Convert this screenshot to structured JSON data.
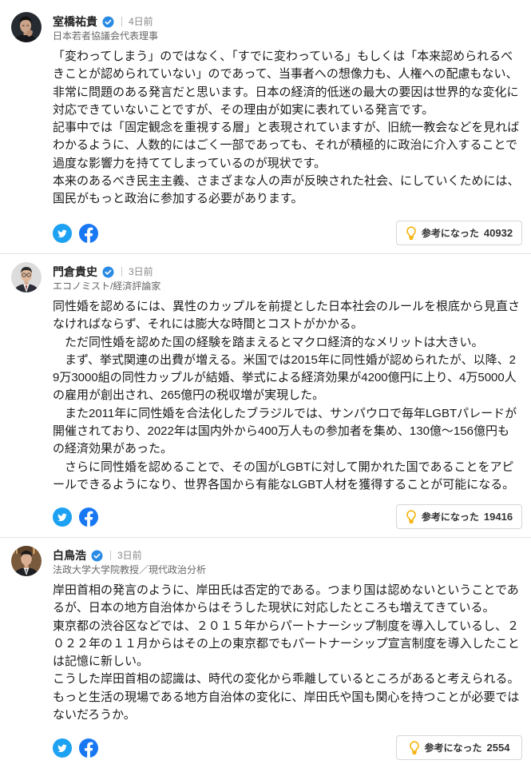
{
  "helpful_label": "参考になった",
  "comments": [
    {
      "author": "室橋祐貴",
      "badge_icon": "verified-check-icon",
      "time": "4日前",
      "title": "日本若者協議会代表理事",
      "paragraphs": [
        "「変わってしまう」のではなく、「すでに変わっている」もしくは「本来認められるべきことが認められていない」のであって、当事者への想像力も、人権への配慮もない、非常に問題のある発言だと思います。日本の経済的低迷の最大の要因は世界的な変化に対応できていないことですが、その理由が如実に表れている発言です。",
        "記事中では「固定観念を重視する層」と表現されていますが、旧統一教会などを見ればわかるように、人数的にはごく一部であっても、それが積極的に政治に介入することで過度な影響力を持ててしまっているのが現状です。",
        "本来のあるべき民主主義、さまざまな人の声が反映された社会、にしていくためには、国民がもっと政治に参加する必要があります。"
      ],
      "helpful_count": "40932"
    },
    {
      "author": "門倉貴史",
      "badge_icon": "verified-check-icon",
      "time": "3日前",
      "title": "エコノミスト/経済評論家",
      "paragraphs": [
        "同性婚を認めるには、異性のカップルを前提とした日本社会のルールを根底から見直さなければならず、それには膨大な時間とコストがかかる。",
        "　ただ同性婚を認めた国の経験を踏まえるとマクロ経済的なメリットは大きい。",
        "　まず、挙式関連の出費が増える。米国では2015年に同性婚が認められたが、以降、29万3000組の同性カップルが結婚、挙式による経済効果が4200億円に上り、4万5000人の雇用が創出され、265億円の税収増が実現した。",
        "　また2011年に同性婚を合法化したブラジルでは、サンパウロで毎年LGBTパレードが開催されており、2022年は国内外から400万人もの参加者を集め、130億～156億円もの経済効果があった。",
        "　さらに同性婚を認めることで、その国がLGBTに対して開かれた国であることをアピールできるようになり、世界各国から有能なLGBT人材を獲得することが可能になる。"
      ],
      "helpful_count": "19416"
    },
    {
      "author": "白鳥浩",
      "badge_icon": "verified-check-icon",
      "time": "3日前",
      "title": "法政大学大学院教授／現代政治分析",
      "paragraphs": [
        "岸田首相の発言のように、岸田氏は否定的である。つまり国は認めないということであるが、日本の地方自治体からはそうした現状に対応したところも増えてきている。",
        "東京都の渋谷区などでは、２０１５年からパートナーシップ制度を導入しているし、２０２２年の１１月からはその上の東京都でもパートナーシップ宣言制度を導入したことは記憶に新しい。",
        "こうした岸田首相の認識は、時代の変化から乖離しているところがあると考えられる。もっと生活の現場である地方自治体の変化に、岸田氏や国も関心を持つことが必要ではないだろうか。"
      ],
      "helpful_count": "2554"
    }
  ],
  "icons": {
    "share_twitter": "twitter-icon",
    "share_facebook": "facebook-icon",
    "helpful": "lightbulb-icon",
    "badge": "verified-check-icon"
  },
  "colors": {
    "twitter": "#1da1f2",
    "facebook": "#1877f2",
    "verified": "#2a8be4",
    "bulb": "#f5b000",
    "text": "#1a1a1a",
    "muted": "#777777",
    "border": "#e5e5e5"
  }
}
